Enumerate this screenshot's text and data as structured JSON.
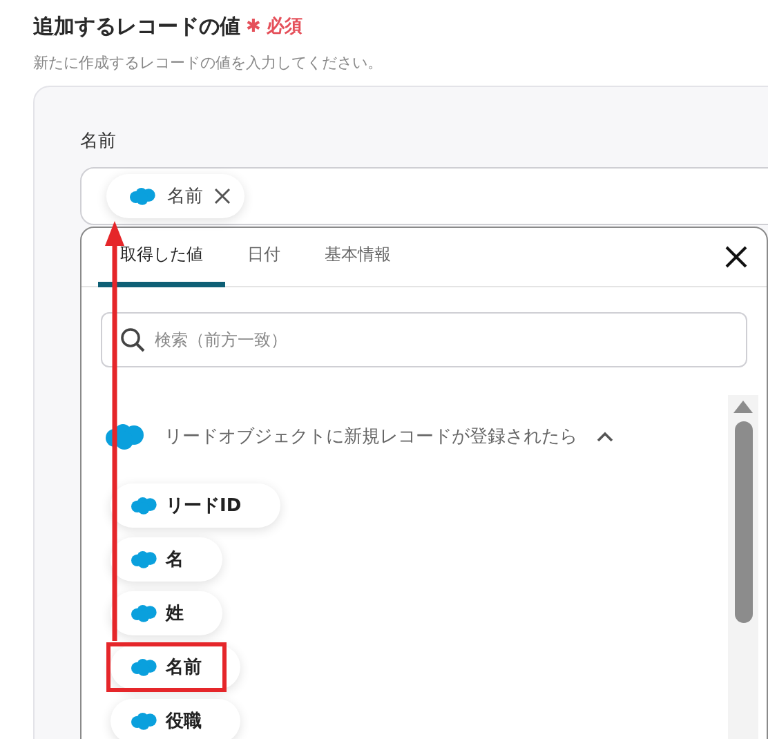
{
  "section": {
    "title": "追加するレコードの値",
    "required_mark": "✱",
    "required_label": "必須",
    "description": "新たに作成するレコードの値を入力してください。"
  },
  "field": {
    "label": "名前",
    "chips": [
      {
        "label": "名前"
      }
    ]
  },
  "picker": {
    "tabs": [
      {
        "label": "取得した値",
        "selected": true
      },
      {
        "label": "日付",
        "selected": false
      },
      {
        "label": "基本情報",
        "selected": false
      }
    ],
    "search": {
      "placeholder": "検索（前方一致）"
    },
    "groups": [
      {
        "title": "リードオブジェクトに新規レコードが登録されたら",
        "expanded": true,
        "items": [
          {
            "label": "リードID",
            "highlighted": false
          },
          {
            "label": "名",
            "highlighted": false
          },
          {
            "label": "姓",
            "highlighted": false
          },
          {
            "label": "名前",
            "highlighted": true
          },
          {
            "label": "役職",
            "highlighted": false
          }
        ]
      }
    ]
  },
  "annotation": {
    "kind": "arrow"
  }
}
